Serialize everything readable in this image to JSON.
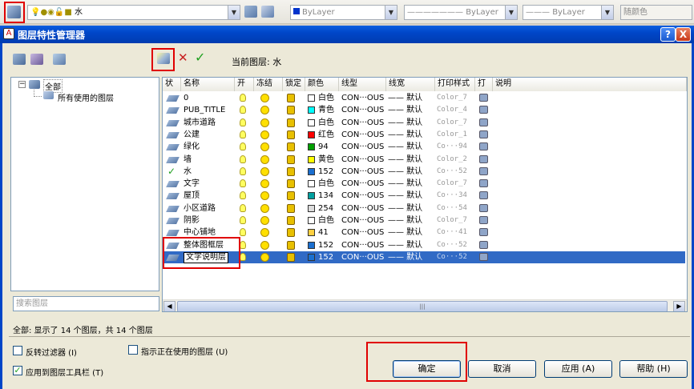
{
  "toolbar": {
    "layer_combo": "水",
    "color_combo": "ByLayer",
    "linetype_combo": "ByLayer",
    "lineweight_combo": "ByLayer",
    "plotstyle_combo": "随颜色"
  },
  "dialog": {
    "title": "图层特性管理器",
    "help_btn": "?",
    "close_btn": "X",
    "current_layer": "当前图层: 水",
    "tree_all": "全部",
    "tree_used": "所有使用的图层",
    "search_placeholder": "搜索图层",
    "status": "全部: 显示了 14 个图层，共 14 个图层",
    "invert_filter": "反转过滤器 (I)",
    "apply_toolbar": "应用到图层工具栏 (T)",
    "indicate_used": "指示正在使用的图层 (U)",
    "ok": "确定",
    "cancel": "取消",
    "apply": "应用 (A)",
    "help": "帮助 (H)"
  },
  "columns": [
    "状",
    "名称",
    "开",
    "冻结",
    "锁定",
    "颜色",
    "线型",
    "线宽",
    "打印样式",
    "打",
    "说明"
  ],
  "layers": [
    {
      "name": "0",
      "color": "白色",
      "hex": "#ffffff",
      "linetype": "CON···OUS",
      "lw": "—— 默认",
      "ps": "Color_7",
      "current": false
    },
    {
      "name": "PUB_TITLE",
      "color": "青色",
      "hex": "#00ffff",
      "linetype": "CON···OUS",
      "lw": "—— 默认",
      "ps": "Color_4",
      "current": false
    },
    {
      "name": "城市道路",
      "color": "白色",
      "hex": "#ffffff",
      "linetype": "CON···OUS",
      "lw": "—— 默认",
      "ps": "Color_7",
      "current": false
    },
    {
      "name": "公建",
      "color": "红色",
      "hex": "#ff0000",
      "linetype": "CON···OUS",
      "lw": "—— 默认",
      "ps": "Color_1",
      "current": false
    },
    {
      "name": "绿化",
      "color": "94",
      "hex": "#00a000",
      "linetype": "CON···OUS",
      "lw": "—— 默认",
      "ps": "Co···94",
      "current": false
    },
    {
      "name": "墙",
      "color": "黄色",
      "hex": "#ffff00",
      "linetype": "CON···OUS",
      "lw": "—— 默认",
      "ps": "Color_2",
      "current": false
    },
    {
      "name": "水",
      "color": "152",
      "hex": "#1a6fd0",
      "linetype": "CON···OUS",
      "lw": "—— 默认",
      "ps": "Co···52",
      "current": true
    },
    {
      "name": "文字",
      "color": "白色",
      "hex": "#ffffff",
      "linetype": "CON···OUS",
      "lw": "—— 默认",
      "ps": "Color_7",
      "current": false
    },
    {
      "name": "屋顶",
      "color": "134",
      "hex": "#00a0a0",
      "linetype": "CON···OUS",
      "lw": "—— 默认",
      "ps": "Co···34",
      "current": false
    },
    {
      "name": "小区道路",
      "color": "254",
      "hex": "#dcdcdc",
      "linetype": "CON···OUS",
      "lw": "—— 默认",
      "ps": "Co···54",
      "current": false
    },
    {
      "name": "阴影",
      "color": "白色",
      "hex": "#ffffff",
      "linetype": "CON···OUS",
      "lw": "—— 默认",
      "ps": "Color_7",
      "current": false
    },
    {
      "name": "中心铺地",
      "color": "41",
      "hex": "#ffd040",
      "linetype": "CON···OUS",
      "lw": "—— 默认",
      "ps": "Co···41",
      "current": false
    },
    {
      "name": "整体图框层",
      "color": "152",
      "hex": "#1a6fd0",
      "linetype": "CON···OUS",
      "lw": "—— 默认",
      "ps": "Co···52",
      "current": false
    },
    {
      "name": "文字说明层",
      "color": "152",
      "hex": "#1a6fd0",
      "linetype": "CON···OUS",
      "lw": "—— 默认",
      "ps": "Co···52",
      "current": false,
      "selected": true
    }
  ]
}
